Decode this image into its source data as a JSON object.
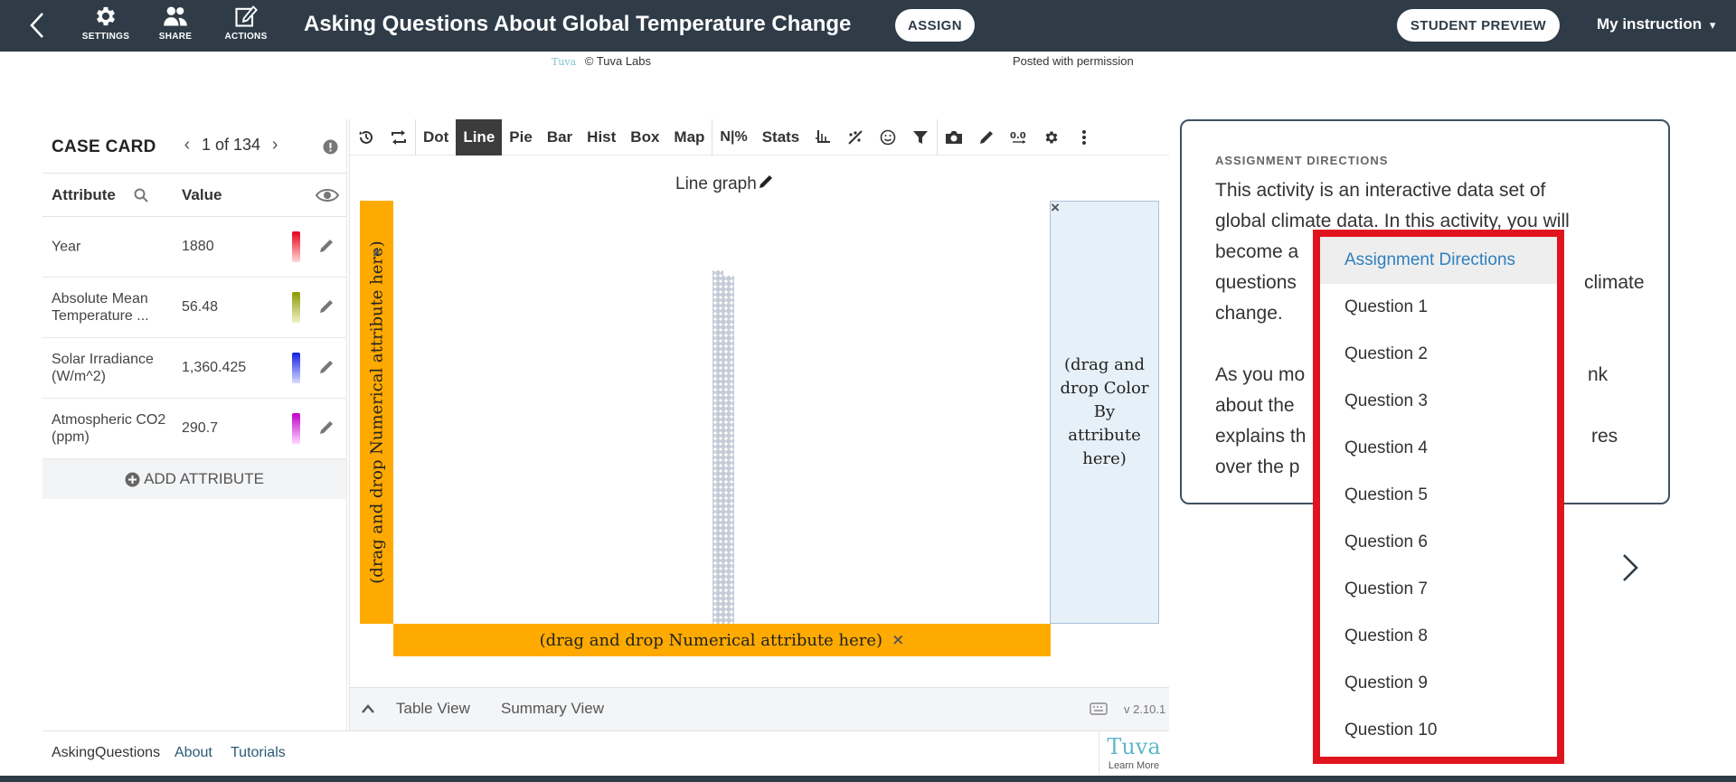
{
  "header": {
    "title": "Asking Questions About Global Temperature Change",
    "tools": [
      {
        "label": "SETTINGS",
        "icon": "gear-icon"
      },
      {
        "label": "SHARE",
        "icon": "users-icon"
      },
      {
        "label": "ACTIONS",
        "icon": "edit-icon"
      }
    ],
    "assign_label": "ASSIGN",
    "student_preview_label": "STUDENT PREVIEW",
    "my_instruction_label": "My instruction"
  },
  "credit": {
    "logo_text": "Tuva",
    "copyright": "© Tuva Labs",
    "permission": "Posted with permission"
  },
  "case_card": {
    "title": "CASE CARD",
    "position": "1 of 134",
    "col_attribute": "Attribute",
    "col_value": "Value",
    "rows": [
      {
        "attribute": "Year",
        "value": "1880",
        "gradient": [
          "#ffd9d9",
          "#e8001b"
        ]
      },
      {
        "attribute": "Absolute Mean Temperature ...",
        "value": "56.48",
        "gradient": [
          "#f2f2c9",
          "#8a9a00"
        ]
      },
      {
        "attribute": "Solar Irradiance (W/m^2)",
        "value": "1,360.425",
        "gradient": [
          "#d9dcff",
          "#1020e0"
        ]
      },
      {
        "attribute": "Atmospheric CO2 (ppm)",
        "value": "290.7",
        "gradient": [
          "#ffd6ff",
          "#c000c8"
        ]
      }
    ],
    "add_attribute_label": "ADD ATTRIBUTE"
  },
  "graph": {
    "toolbar_types": [
      "Dot",
      "Line",
      "Pie",
      "Bar",
      "Hist",
      "Box",
      "Map"
    ],
    "active_type": "Line",
    "n_percent_label": "N|%",
    "stats_label": "Stats",
    "title": "Line graph",
    "y_drop_label": "(drag and drop Numerical attribute here)",
    "x_drop_label": "(drag and drop Numerical attribute here)",
    "color_drop_label": "(drag and drop Color By attribute here)",
    "table_view_label": "Table View",
    "summary_view_label": "Summary View",
    "version": "v 2.10.1"
  },
  "footer": {
    "links": [
      "AskingQuestions",
      "About",
      "Tutorials"
    ],
    "logo_text": "Tuva",
    "learn_more": "Learn More"
  },
  "directions": {
    "heading": "ASSIGNMENT DIRECTIONS",
    "line1": "This activity is an interactive data set of",
    "line2": "global climate data. In this activity, you will",
    "line3a": "become a",
    "line4a": "questions",
    "line4b": "climate",
    "line5": "change.",
    "line6a": "As you mo",
    "line6b": "nk",
    "line7a": "about the",
    "line8a": "explains th",
    "line8b": "res",
    "line9a": "over the p"
  },
  "dropdown": {
    "items": [
      "Assignment Directions",
      "Question 1",
      "Question 2",
      "Question 3",
      "Question 4",
      "Question 5",
      "Question 6",
      "Question 7",
      "Question 8",
      "Question 9",
      "Question 10"
    ],
    "selected_index": 0
  },
  "colors": {
    "header_bg": "#2f3c48",
    "drop_orange": "#ffaa00",
    "highlight_red": "#e0141e",
    "link_blue": "#2f7fbf"
  }
}
